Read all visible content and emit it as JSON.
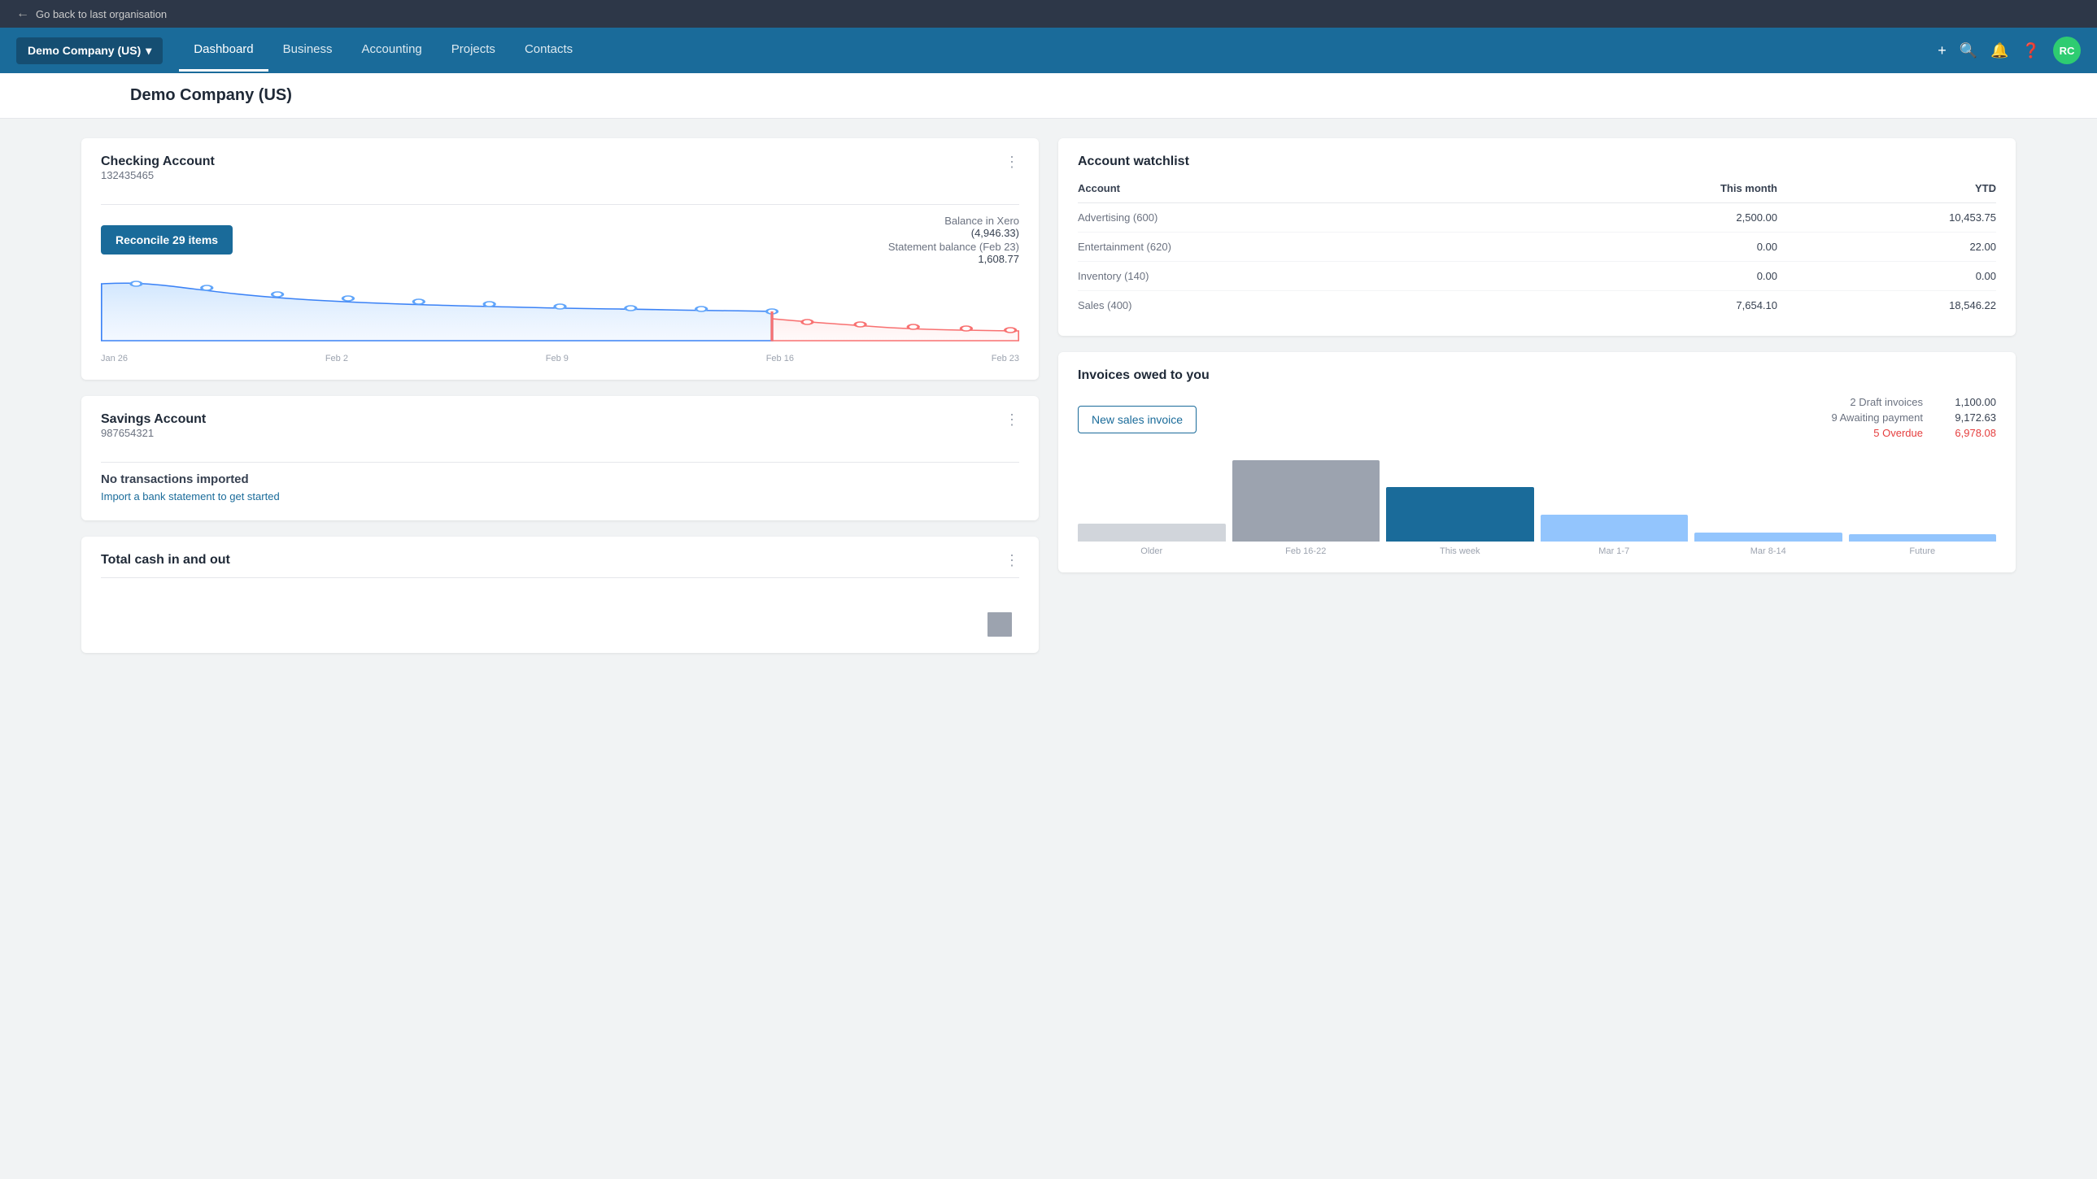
{
  "topBar": {
    "backLabel": "Go back to last organisation"
  },
  "nav": {
    "brand": "Demo Company (US)",
    "brandCaret": "▾",
    "links": [
      {
        "label": "Dashboard",
        "active": true
      },
      {
        "label": "Business",
        "active": false
      },
      {
        "label": "Accounting",
        "active": false
      },
      {
        "label": "Projects",
        "active": false
      },
      {
        "label": "Contacts",
        "active": false
      }
    ],
    "avatar": "RC"
  },
  "pageTitle": "Demo Company (US)",
  "checkingAccount": {
    "title": "Checking Account",
    "accountNumber": "132435465",
    "reconcileLabel": "Reconcile 29 items",
    "balanceInXeroLabel": "Balance in Xero",
    "balanceInXeroValue": "(4,946.33)",
    "statementBalanceLabel": "Statement balance (Feb 23)",
    "statementBalanceValue": "1,608.77",
    "chartLabels": [
      "Jan 26",
      "Feb 2",
      "Feb 9",
      "Feb 16",
      "Feb 23"
    ]
  },
  "savingsAccount": {
    "title": "Savings Account",
    "accountNumber": "987654321",
    "noTransactionsLabel": "No transactions imported",
    "importLinkLabel": "Import a bank statement to get started"
  },
  "totalCash": {
    "title": "Total cash in and out"
  },
  "accountWatchlist": {
    "title": "Account watchlist",
    "columns": [
      "Account",
      "This month",
      "YTD"
    ],
    "rows": [
      {
        "account": "Advertising (600)",
        "thisMonth": "2,500.00",
        "ytd": "10,453.75"
      },
      {
        "account": "Entertainment (620)",
        "thisMonth": "0.00",
        "ytd": "22.00"
      },
      {
        "account": "Inventory (140)",
        "thisMonth": "0.00",
        "ytd": "0.00"
      },
      {
        "account": "Sales (400)",
        "thisMonth": "7,654.10",
        "ytd": "18,546.22"
      }
    ]
  },
  "invoicesOwed": {
    "title": "Invoices owed to you",
    "newInvoiceLabel": "New sales invoice",
    "draftLabel": "2 Draft invoices",
    "draftValue": "1,100.00",
    "awaitingLabel": "9 Awaiting payment",
    "awaitingValue": "9,172.63",
    "overdueLabel": "5 Overdue",
    "overdueValue": "6,978.08",
    "barChart": {
      "bars": [
        {
          "label": "Older",
          "height": 20,
          "color": "#d1d5db"
        },
        {
          "label": "Feb 16-22",
          "height": 90,
          "color": "#9ca3af"
        },
        {
          "label": "This week",
          "height": 60,
          "color": "#1a6b9a"
        },
        {
          "label": "Mar 1-7",
          "height": 30,
          "color": "#93c5fd"
        },
        {
          "label": "Mar 8-14",
          "height": 10,
          "color": "#93c5fd"
        },
        {
          "label": "Future",
          "height": 8,
          "color": "#93c5fd"
        }
      ]
    }
  }
}
